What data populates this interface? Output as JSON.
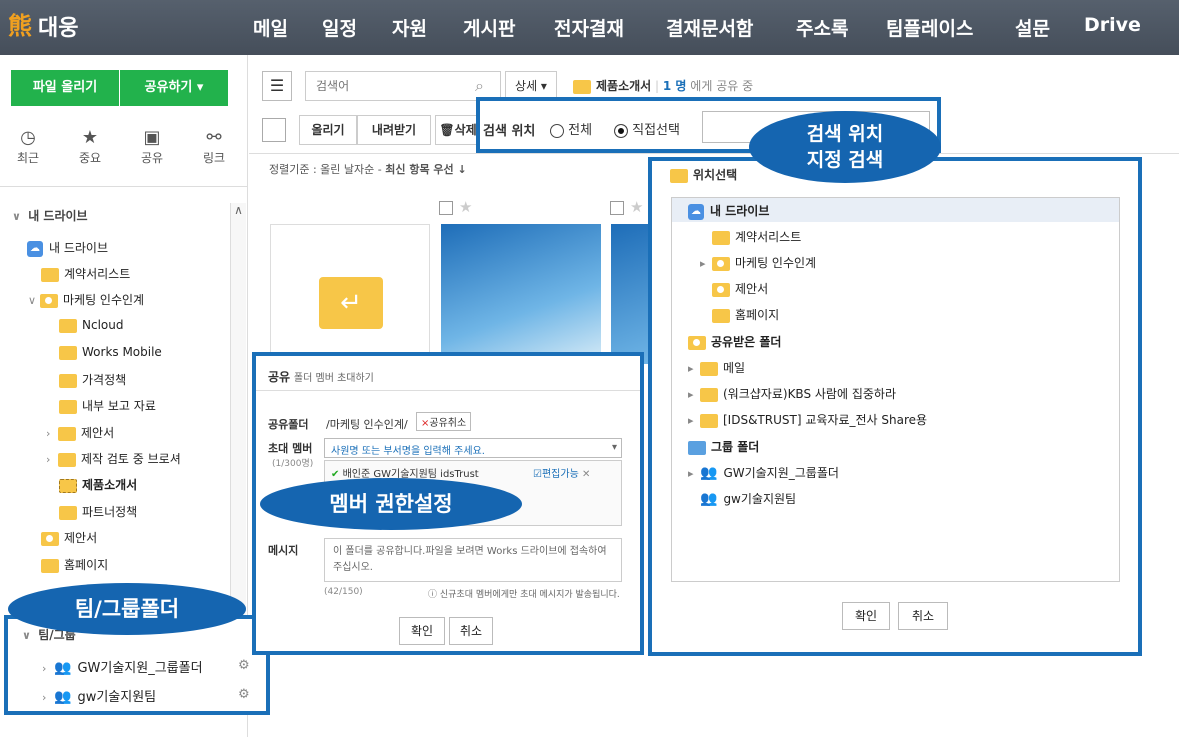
{
  "app": {
    "logo_text": "대웅",
    "logo_icon": "bear-logo-icon"
  },
  "nav": [
    "메일",
    "일정",
    "자원",
    "게시판",
    "전자결재",
    "결재문서함",
    "주소록",
    "팀플레이스",
    "설문",
    "Drive"
  ],
  "sidebar": {
    "upload_label": "파일 올리기",
    "share_label": "공유하기 ▾",
    "quick": [
      {
        "icon": "clock-icon",
        "label": "최근",
        "glyph": "◷"
      },
      {
        "icon": "star-icon",
        "label": "중요",
        "glyph": "★"
      },
      {
        "icon": "share-icon",
        "label": "공유",
        "glyph": "▣"
      },
      {
        "icon": "link-icon",
        "label": "링크",
        "glyph": "⚯"
      }
    ],
    "my_drive_header": "내 드라이브",
    "tree": [
      "내 드라이브",
      "계약서리스트",
      "마케팅 인수인계",
      "Ncloud",
      "Works Mobile",
      "가격정책",
      "내부 보고 자료",
      "제안서",
      "제작 검토 중 브로셔",
      "제품소개서",
      "파트너정책",
      "제안서",
      "홈페이지"
    ],
    "team_header": "팀/그룹",
    "teams": [
      "GW기술지원_그룹폴더",
      "gw기술지원팀"
    ]
  },
  "toolbar": {
    "search_placeholder": "검색어",
    "detail_label": "상세 ▾",
    "folder_title": "제품소개서",
    "share_count": "1 명",
    "share_suffix": "에게 공유 중",
    "upload": "올리기",
    "download": "내려받기",
    "delete": "삭제",
    "sort_prefix": "정렬기준 : 올린 날자순 -",
    "sort_value": "최신 항목 우선 ↓"
  },
  "search_scope": {
    "label": "검색 위치",
    "all": "전체",
    "direct": "직접선택"
  },
  "callouts": {
    "search": [
      "검색 위치",
      "지정 검색"
    ],
    "member": "멤버 권한설정",
    "team": "팀/그룹폴더"
  },
  "share_dialog": {
    "title": "공유",
    "subtitle": "폴더 멤버 초대하기",
    "folder_label": "공유폴더",
    "folder_path": "/마케팅 인수인계/",
    "cancel_share": "공유취소",
    "invite_label": "초대 멤버",
    "invite_count": "(1/300명)",
    "invite_placeholder": "사원명 또는 부서명을 입력해 주세요.",
    "member": "배인준 GW기술지원팀 idsTrust",
    "edit_label": "편집가능",
    "message_label": "메시지",
    "message_text": "이 폴더를 공유합니다.파일을 보려면 Works 드라이브에 접속하여 주십시오.",
    "char_count": "(42/150)",
    "notice": "신규초대 멤버에게만 초대 메시지가 발송됩니다.",
    "ok": "확인",
    "cancel": "취소"
  },
  "location_dialog": {
    "title": "위치선택",
    "items": [
      "내 드라이브",
      "계약서리스트",
      "마케팅 인수인계",
      "제안서",
      "홈페이지",
      "공유받은 폴더",
      "메일",
      "(워크샵자료)KBS 사람에 집중하라",
      "[IDS&TRUST] 교육자료_전사 Share용",
      "그룹 폴더",
      "GW기술지원_그룹폴더",
      "gw기술지원팀"
    ],
    "ok": "확인",
    "cancel": "취소"
  }
}
